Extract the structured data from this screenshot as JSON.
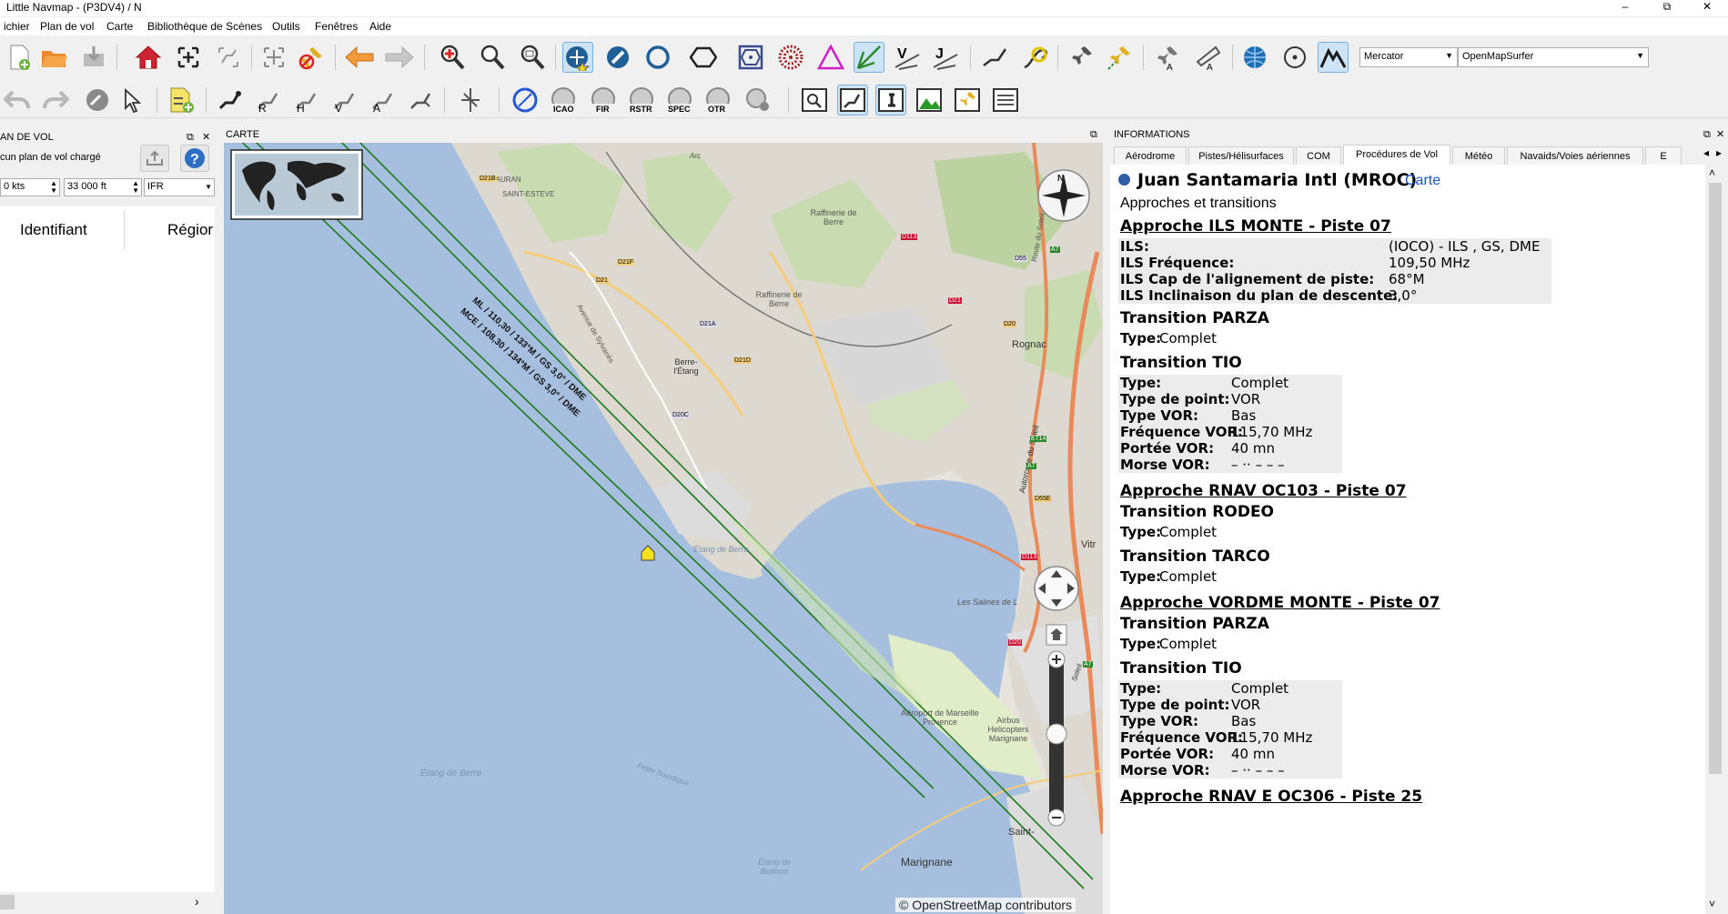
{
  "window": {
    "title": "Little Navmap - (P3DV4) / N",
    "controls": {
      "minimize": "–",
      "maximize": "⧉",
      "close": "✕"
    }
  },
  "menu": [
    "ichier",
    "Plan de vol",
    "Carte",
    "Bibliothèque de Scènes",
    "Outils",
    "Fenêtres",
    "Aide"
  ],
  "toolbar": {
    "projection": "Mercator",
    "theme": "OpenMapSurfer",
    "labels": {
      "icao": "ICAO",
      "fir": "FIR",
      "rstr": "RSTR",
      "spec": "SPEC",
      "otr": "OTR"
    }
  },
  "flightplan": {
    "title": "AN DE VOL",
    "status": "cun plan de vol chargé",
    "speed": "0 kts",
    "altitude": "33 000 ft",
    "rules": "IFR",
    "columns": [
      "Identifiant",
      "Régior"
    ]
  },
  "map": {
    "title": "CARTE",
    "attribution": "© OpenStreetMap contributors",
    "compass": "N",
    "labels": {
      "mauran": "MAURAN",
      "saint_esteve": "SAINT-ESTEVE",
      "raffinerie1": "Raffinerie de Berre",
      "raffinerie2": "Raffinerie de Berre",
      "rognac": "Rognac",
      "etang": "Étang de Berre",
      "etang2": "Étang de Berre",
      "etang_bolmon": "Étang de Bolmon",
      "salines": "Les Salines de L",
      "marignane": "Marignane",
      "airbus": "Airbus Helicopters Marignane",
      "marseille": "Aéroport de Marseille Provence",
      "saint": "Saint-",
      "vitr": "Vitr",
      "petite_bourdigue": "Petite Bourdigue",
      "berre_etang": "Berre-l'Étang",
      "avenue": "Avenue de Sylvanès",
      "autoroute": "Autoroute du Soleil",
      "route": "Route du Soleil",
      "soleil": "Soleil",
      "arc": "Arc"
    },
    "roads": [
      "D21B",
      "D21F",
      "D21",
      "D21A",
      "D21D",
      "D20C",
      "D113",
      "D55",
      "A7",
      "D21",
      "D20",
      "E714",
      "A7",
      "D55E",
      "D113",
      "D20",
      "A7"
    ],
    "ils_label_1": "ML / 110,30 / 133°M / GS 3,0° / DME",
    "ils_label_2": "MCE / 108,30 / 134°M / GS 3,0° / DME"
  },
  "info": {
    "title": "INFORMATIONS",
    "tabs": [
      "Aérodrome",
      "Pistes/Hélisurfaces",
      "COM",
      "Procédures de Vol",
      "Météo",
      "Navaids/Voies aériennes",
      "E"
    ],
    "selected_tab": 3,
    "airport": "Juan Santamaria Intl (MROC)",
    "airport_link": "Carte",
    "subtitle": "Approches et transitions",
    "approaches": [
      {
        "title": "Approche ILS MONTE - Piste 07",
        "rows": [
          [
            "ILS:",
            "(IOCO) - ILS , GS, DME"
          ],
          [
            "ILS Fréquence:",
            "109,50 MHz"
          ],
          [
            "ILS Cap de l'alignement de piste:",
            "68°M"
          ],
          [
            "ILS Inclinaison du plan de descente:",
            "3,0°"
          ]
        ],
        "transitions": [
          {
            "title": "Transition PARZA",
            "rows": [
              [
                "Type:",
                "Complet"
              ]
            ]
          },
          {
            "title": "Transition TIO",
            "rows": [
              [
                "Type:",
                "Complet"
              ],
              [
                "Type de point:",
                "VOR"
              ],
              [
                "Type VOR:",
                "Bas"
              ],
              [
                "Fréquence VOR:",
                "115,70 MHz"
              ],
              [
                "Portée VOR:",
                "40 mn"
              ],
              [
                "Morse VOR:",
                "–  ··  – – –"
              ]
            ]
          }
        ]
      },
      {
        "title": "Approche RNAV OC103 - Piste 07",
        "rows": [],
        "transitions": [
          {
            "title": "Transition RODEO",
            "rows": [
              [
                "Type:",
                "Complet"
              ]
            ]
          },
          {
            "title": "Transition TARCO",
            "rows": [
              [
                "Type:",
                "Complet"
              ]
            ]
          }
        ]
      },
      {
        "title": "Approche VORDME MONTE - Piste 07",
        "rows": [],
        "transitions": [
          {
            "title": "Transition PARZA",
            "rows": [
              [
                "Type:",
                "Complet"
              ]
            ]
          },
          {
            "title": "Transition TIO",
            "rows": [
              [
                "Type:",
                "Complet"
              ],
              [
                "Type de point:",
                "VOR"
              ],
              [
                "Type VOR:",
                "Bas"
              ],
              [
                "Fréquence VOR:",
                "115,70 MHz"
              ],
              [
                "Portée VOR:",
                "40 mn"
              ],
              [
                "Morse VOR:",
                "–  ··  – – –"
              ]
            ]
          }
        ]
      },
      {
        "title": "Approche RNAV E OC306 - Piste 25",
        "rows": [],
        "transitions": []
      }
    ]
  }
}
